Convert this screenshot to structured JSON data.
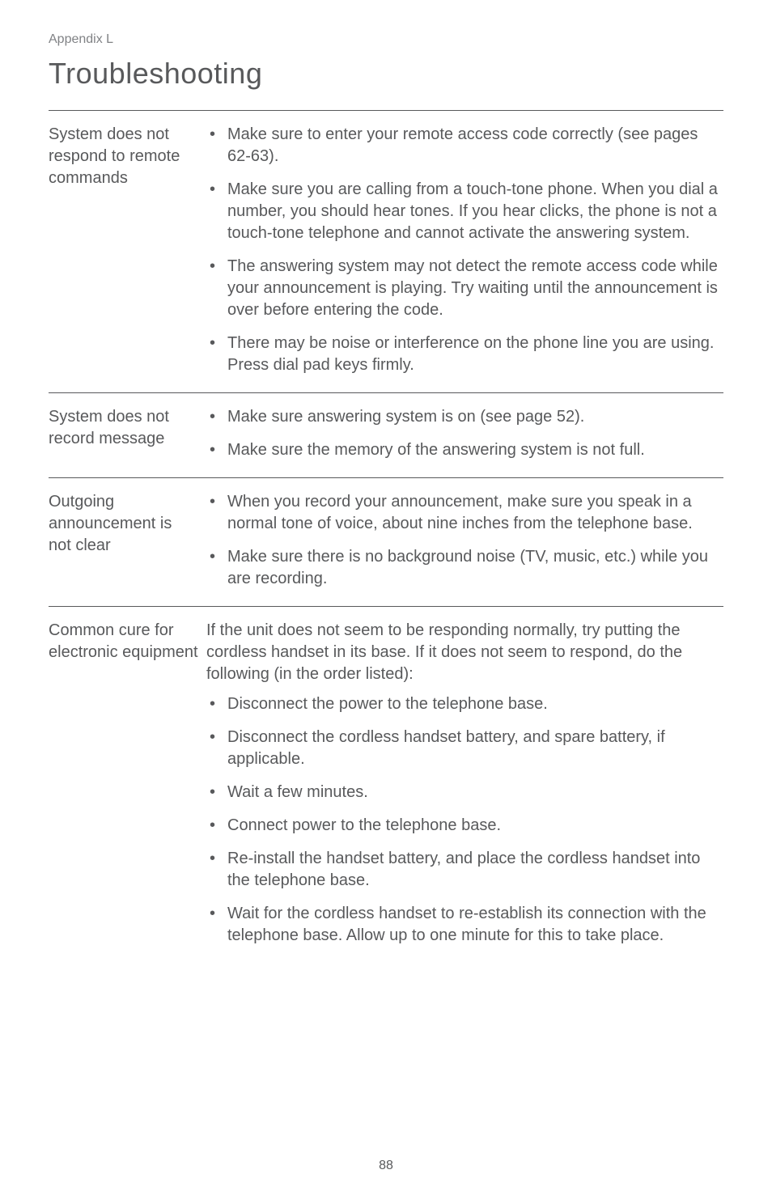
{
  "header": {
    "appendix": "Appendix L",
    "title": "Troubleshooting"
  },
  "sections": [
    {
      "label": "System does not respond to remote commands",
      "items": [
        "Make sure to enter your remote access code correctly (see pages 62-63).",
        "Make sure you are calling from a touch-tone phone. When you dial a number, you should hear tones. If you hear clicks, the phone is not a touch-tone telephone and cannot activate the answering system.",
        "The answering system may not detect the remote access code while your announcement is playing. Try waiting until the announcement is over before entering the code.",
        "There may be noise or interference on the phone line you are using. Press dial pad keys firmly."
      ]
    },
    {
      "label": "System does not record message",
      "items": [
        "Make sure answering system is on (see page 52).",
        "Make sure the memory of the answering system is not full."
      ]
    },
    {
      "label": "Outgoing announcement is not clear",
      "items": [
        "When you record your announcement, make sure you speak in a normal tone of voice, about nine inches from the telephone base.",
        "Make sure there is no background noise (TV, music, etc.) while you are recording."
      ]
    },
    {
      "label": "Common cure for electronic equipment",
      "intro": "If the unit does not seem to be responding normally, try putting the cordless handset in its base. If it does not seem to respond, do the following (in the order listed):",
      "items": [
        "Disconnect the power to the telephone base.",
        "Disconnect the cordless handset battery, and spare battery, if applicable.",
        "Wait a few minutes.",
        "Connect power to the telephone base.",
        "Re-install the handset battery, and place the cordless handset into the telephone base.",
        "Wait for the cordless handset to re-establish its connection with the telephone base. Allow up to one minute for this to take place."
      ]
    }
  ],
  "page_number": "88"
}
